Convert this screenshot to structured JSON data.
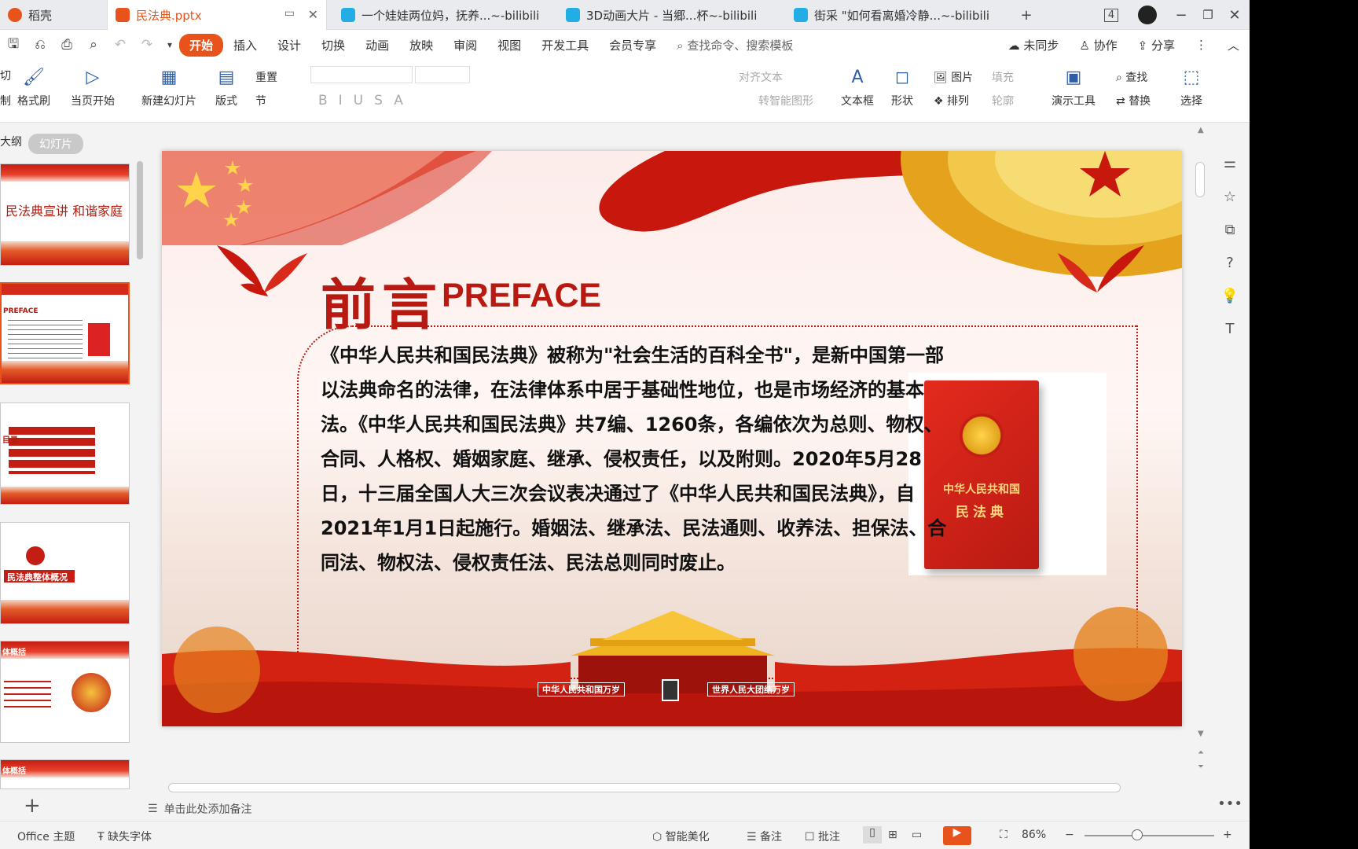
{
  "tabs": [
    {
      "label": "稻壳",
      "icon": "daoke-icon",
      "color": "#e8531c",
      "active": false
    },
    {
      "label": "民法典.pptx",
      "icon": "ppt-icon",
      "color": "#e8531c",
      "active": true
    },
    {
      "label": "一个娃娃两位妈，抚养...~-bilibili",
      "icon": "bilibili-icon",
      "color": "#23ade5",
      "active": false
    },
    {
      "label": "3D动画大片 - 当郷...杯~-bilibili",
      "icon": "bilibili-icon",
      "color": "#23ade5",
      "active": false
    },
    {
      "label": "街采 \"如何看离婚冷静...~-bilibili",
      "icon": "bilibili-icon",
      "color": "#23ade5",
      "active": false
    }
  ],
  "tabcount": "4",
  "menu": {
    "items": [
      "开始",
      "插入",
      "设计",
      "切换",
      "动画",
      "放映",
      "审阅",
      "视图",
      "开发工具",
      "会员专享"
    ],
    "active": "开始",
    "search_placeholder": "查找命令、搜索模板",
    "sync": "未同步",
    "collab": "协作",
    "share": "分享"
  },
  "ribbon": {
    "cut": "切",
    "copy": "制",
    "format_painter": "格式刷",
    "from_current": "当页开始",
    "new_slide": "新建幻灯片",
    "layout": "版式",
    "section": "节",
    "reset": "重置",
    "align_text": "对齐文本",
    "convert_smartart": "转智能图形",
    "textbox": "文本框",
    "shape": "形状",
    "picture": "图片",
    "arrange": "排列",
    "fill": "填充",
    "outline": "轮廓",
    "presentation_tools": "演示工具",
    "find": "查找",
    "replace": "替换",
    "select": "选择"
  },
  "leftpanel": {
    "outline_tab": "大纲",
    "slides_tab": "幻灯片",
    "thumbs": [
      {
        "text": "民法典宣讲 和谐家庭"
      },
      {
        "text": "PREFACE"
      },
      {
        "text": "目录"
      },
      {
        "text": "民法典整体概况"
      },
      {
        "text": "体概括"
      },
      {
        "text": "体概括"
      }
    ]
  },
  "slide": {
    "title_cn": "前言",
    "title_en": "PREFACE",
    "body": "《中华人民共和国民法典》被称为\"社会生活的百科全书\"，是新中国第一部以法典命名的法律，在法律体系中居于基础性地位，也是市场经济的基本法。《中华人民共和国民法典》共7编、1260条，各编依次为总则、物权、合同、人格权、婚姻家庭、继承、侵权责任，以及附则。2020年5月28日，十三届全国人大三次会议表决通过了《中华人民共和国民法典》，自2021年1月1日起施行。婚姻法、继承法、民法通则、收养法、担保法、合同法、物权法、侵权责任法、民法总则同时废止。",
    "book_line1": "中华人民共和国",
    "book_line2": "民法典",
    "sign_left": "中华人民共和国万岁",
    "sign_right": "世界人民大团结万岁"
  },
  "notes_placeholder": "单击此处添加备注",
  "status": {
    "theme": "Office 主题",
    "missing_font": "缺失字体",
    "beautify": "智能美化",
    "notes": "备注",
    "comments": "批注",
    "zoom": "86%"
  },
  "colors": {
    "accent": "#e8531c",
    "slide_red": "#b81a12"
  }
}
